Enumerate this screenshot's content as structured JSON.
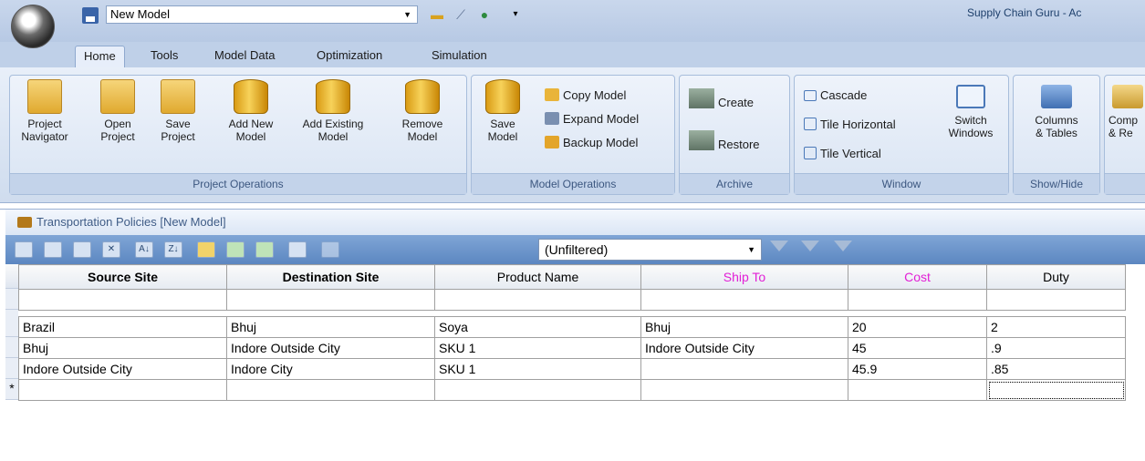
{
  "window": {
    "model_name": "New Model",
    "app_title": "Supply Chain Guru - Ac"
  },
  "tabs": [
    "Home",
    "Tools",
    "Model Data",
    "Optimization",
    "Simulation"
  ],
  "ribbon": {
    "project_operations": {
      "label": "Project Operations",
      "buttons": [
        {
          "line1": "Project",
          "line2": "Navigator"
        },
        {
          "line1": "Open",
          "line2": "Project"
        },
        {
          "line1": "Save",
          "line2": "Project"
        },
        {
          "line1": "Add New",
          "line2": "Model"
        },
        {
          "line1": "Add Existing",
          "line2": "Model"
        },
        {
          "line1": "Remove",
          "line2": "Model"
        }
      ]
    },
    "model_operations": {
      "label": "Model Operations",
      "save_line1": "Save",
      "save_line2": "Model",
      "copy": "Copy Model",
      "expand": "Expand Model",
      "backup": "Backup Model"
    },
    "archive": {
      "label": "Archive",
      "create": "Create",
      "restore": "Restore"
    },
    "window": {
      "label": "Window",
      "cascade": "Cascade",
      "tile_horizontal": "Tile Horizontal",
      "tile_vertical": "Tile Vertical",
      "switch_line1": "Switch",
      "switch_line2": "Windows"
    },
    "show_hide": {
      "label": "Show/Hide",
      "line1": "Columns",
      "line2": "& Tables"
    },
    "compare": {
      "line1": "Comp",
      "line2": "& Re"
    }
  },
  "document": {
    "title": "Transportation Policies [New Model]",
    "filter_value": "(Unfiltered)"
  },
  "grid": {
    "columns": [
      "Source Site",
      "Destination Site",
      "Product Name",
      "Ship To",
      "Cost",
      "Duty"
    ],
    "rows": [
      [
        "Brazil",
        "Bhuj",
        "Soya",
        "Bhuj",
        "20",
        "2"
      ],
      [
        "Bhuj",
        "Indore Outside City",
        "SKU 1",
        "Indore Outside City",
        "45",
        ".9"
      ],
      [
        "Indore Outside City",
        "Indore City",
        "SKU 1",
        "",
        "45.9",
        ".85"
      ]
    ],
    "new_row_marker": "*"
  },
  "colors": {
    "required_header": "#e21fd6",
    "ribbon": "#dbe6f5"
  }
}
